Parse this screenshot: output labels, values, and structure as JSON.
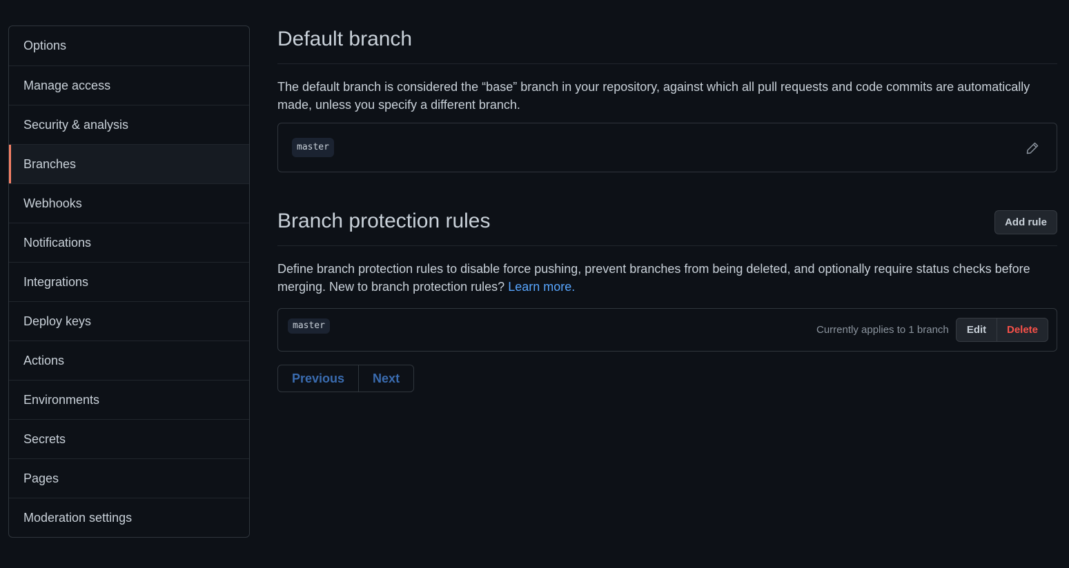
{
  "sidebar": {
    "items": [
      {
        "label": "Options"
      },
      {
        "label": "Manage access"
      },
      {
        "label": "Security & analysis"
      },
      {
        "label": "Branches",
        "selected": true
      },
      {
        "label": "Webhooks"
      },
      {
        "label": "Notifications"
      },
      {
        "label": "Integrations"
      },
      {
        "label": "Deploy keys"
      },
      {
        "label": "Actions"
      },
      {
        "label": "Environments"
      },
      {
        "label": "Secrets"
      },
      {
        "label": "Pages"
      },
      {
        "label": "Moderation settings"
      }
    ],
    "accent_color": "#f78166"
  },
  "default_branch": {
    "title": "Default branch",
    "description": "The default branch is considered the “base” branch in your repository, against which all pull requests and code commits are automatically made, unless you specify a different branch.",
    "branch": "master",
    "edit_icon": "pencil-icon"
  },
  "protection": {
    "title": "Branch protection rules",
    "add_rule_label": "Add rule",
    "description": "Define branch protection rules to disable force pushing, prevent branches from being deleted, and optionally require status checks before merging. New to branch protection rules?",
    "learn_more": "Learn more.",
    "rules": [
      {
        "branch": "master",
        "applies": "Currently applies to 1 branch",
        "edit_label": "Edit",
        "delete_label": "Delete"
      }
    ]
  },
  "pagination": {
    "previous": "Previous",
    "next": "Next"
  },
  "colors": {
    "background": "#0d1117",
    "link": "#58a6ff",
    "danger": "#f85149"
  }
}
